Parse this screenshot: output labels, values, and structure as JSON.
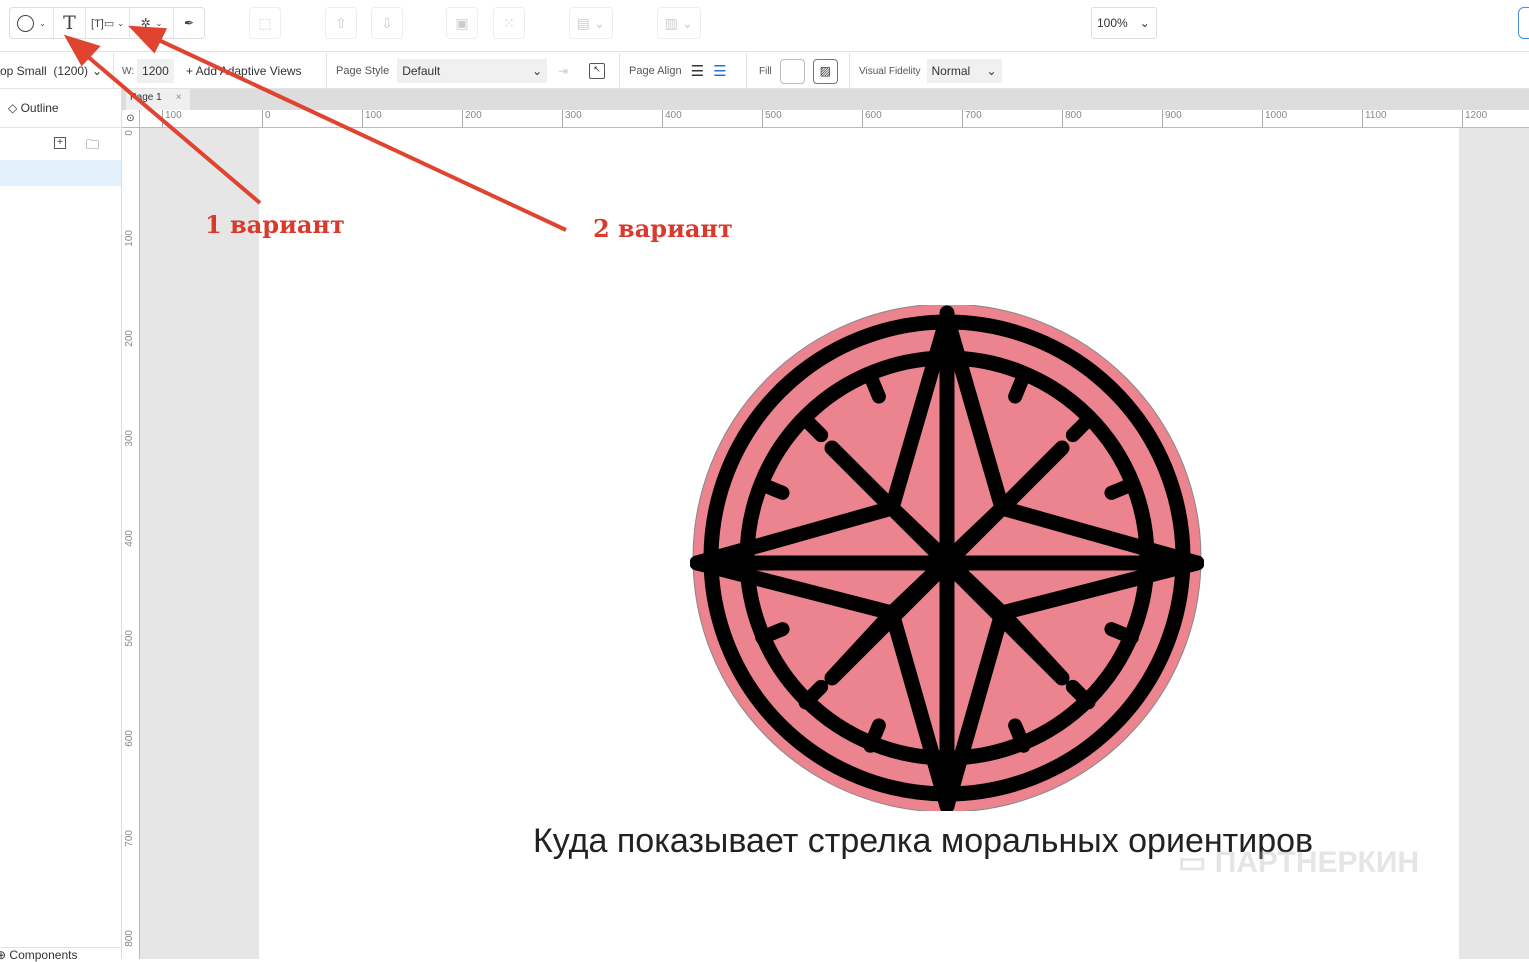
{
  "toolbar": {
    "zoom": "100%"
  },
  "viewbar": {
    "device": "op Small  (1200)",
    "width_label": "W:",
    "width": "1200",
    "add_views": "+ Add Adaptive Views",
    "page_style_label": "Page Style",
    "page_style": "Default",
    "page_align_label": "Page Align",
    "fill_label": "Fill",
    "fidelity_label": "Visual Fidelity",
    "fidelity": "Normal"
  },
  "sidebar": {
    "outline": "Outline",
    "components": "Components"
  },
  "tabs": [
    {
      "label": "Page 1"
    }
  ],
  "ruler": {
    "h": [
      "100",
      "0",
      "100",
      "200",
      "300",
      "400",
      "500",
      "600",
      "700",
      "800",
      "900",
      "1000",
      "1100",
      "1200"
    ],
    "v": [
      "0",
      "100",
      "200",
      "300",
      "400",
      "500",
      "600",
      "700",
      "800"
    ]
  },
  "canvas": {
    "caption": "Куда показывает стрелка моральных ориентиров",
    "watermark": "ПАРТНЕРКИН",
    "compass_fill": "#ec8490"
  },
  "annotations": {
    "a1": "1 вариант",
    "a2": "2 вариант",
    "color": "#d93a2b"
  }
}
